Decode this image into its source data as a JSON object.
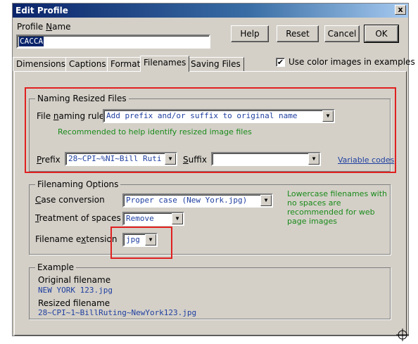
{
  "window": {
    "title": "Edit Profile",
    "close_glyph": "x"
  },
  "profile": {
    "label_pre": "Profile ",
    "label_u": "N",
    "label_post": "ame",
    "value": "CACCA"
  },
  "buttons": {
    "help": "Help",
    "reset": "Reset",
    "cancel": "Cancel",
    "ok": "OK"
  },
  "tabs": [
    "Dimensions",
    "Captions",
    "Format",
    "Filenames",
    "Saving Files"
  ],
  "active_tab": "Filenames",
  "use_color": {
    "label": "Use color images in examples",
    "checked": "✔"
  },
  "naming": {
    "title": "Naming Resized Files",
    "rule_label_pre": "File ",
    "rule_label_u": "n",
    "rule_label_post": "aming rule",
    "rule_value": "Add prefix and/or suffix to original name",
    "rule_hint": "Recommended to help identify resized image files",
    "prefix_label_u": "P",
    "prefix_label_post": "refix",
    "prefix_value": "28~CPI~%NI~Bill Ruti",
    "suffix_label_u": "S",
    "suffix_label_post": "uffix",
    "suffix_value": "",
    "variable_codes": "Variable codes"
  },
  "filenaming": {
    "title": "Filenaming Options",
    "case_label_u": "C",
    "case_label_post": "ase conversion",
    "case_value": "Proper case (New York.jpg)",
    "spaces_label_u": "T",
    "spaces_label_post": "reatment of spaces",
    "spaces_value": "Remove",
    "ext_label_pre": "Filename e",
    "ext_label_u": "x",
    "ext_label_post": "tension",
    "ext_value": "jpg",
    "hint": "Lowercase filenames with no spaces are recommended for web page images"
  },
  "example": {
    "title": "Example",
    "original_label": "Original filename",
    "original_value": "NEW YORK 123.jpg",
    "resized_label": "Resized filename",
    "resized_value": "28~CPI~1~BillRuting~NewYork123.jpg"
  },
  "colors": {
    "highlight_red": "#e02020",
    "hint_green": "#1a8a1a",
    "value_blue": "#1f3fa0"
  }
}
